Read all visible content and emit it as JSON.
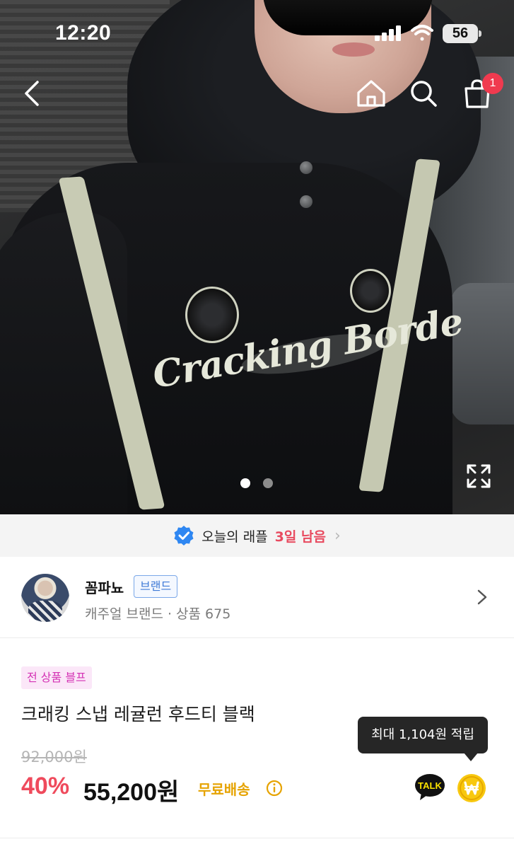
{
  "status_bar": {
    "time": "12:20",
    "battery": "56"
  },
  "nav": {
    "cart_count": "1"
  },
  "hero": {
    "print_text": "Cracking Borde",
    "carousel": {
      "total": 2,
      "active": 1
    }
  },
  "raffle": {
    "text": "오늘의 래플",
    "remaining": "3일 남음"
  },
  "seller": {
    "name": "꼼파뇨",
    "badge": "브랜드",
    "meta": "캐주얼 브랜드 · 상품 675"
  },
  "product": {
    "tag": "전 상품 블프",
    "title": "크래킹 스냅 레귤런 후드티 블랙",
    "original_price": "92,000원",
    "discount": "40%",
    "price": "55,200원",
    "shipping": "무료배송"
  },
  "tooltip": {
    "text": "최대 1,104원 적립"
  },
  "colors": {
    "accent_red": "#ef4a5c",
    "shipping_yellow": "#e6a300",
    "brand_blue": "#3f7ad6",
    "tag_pink": "#d432b4",
    "kakao_yellow": "#fae100"
  }
}
